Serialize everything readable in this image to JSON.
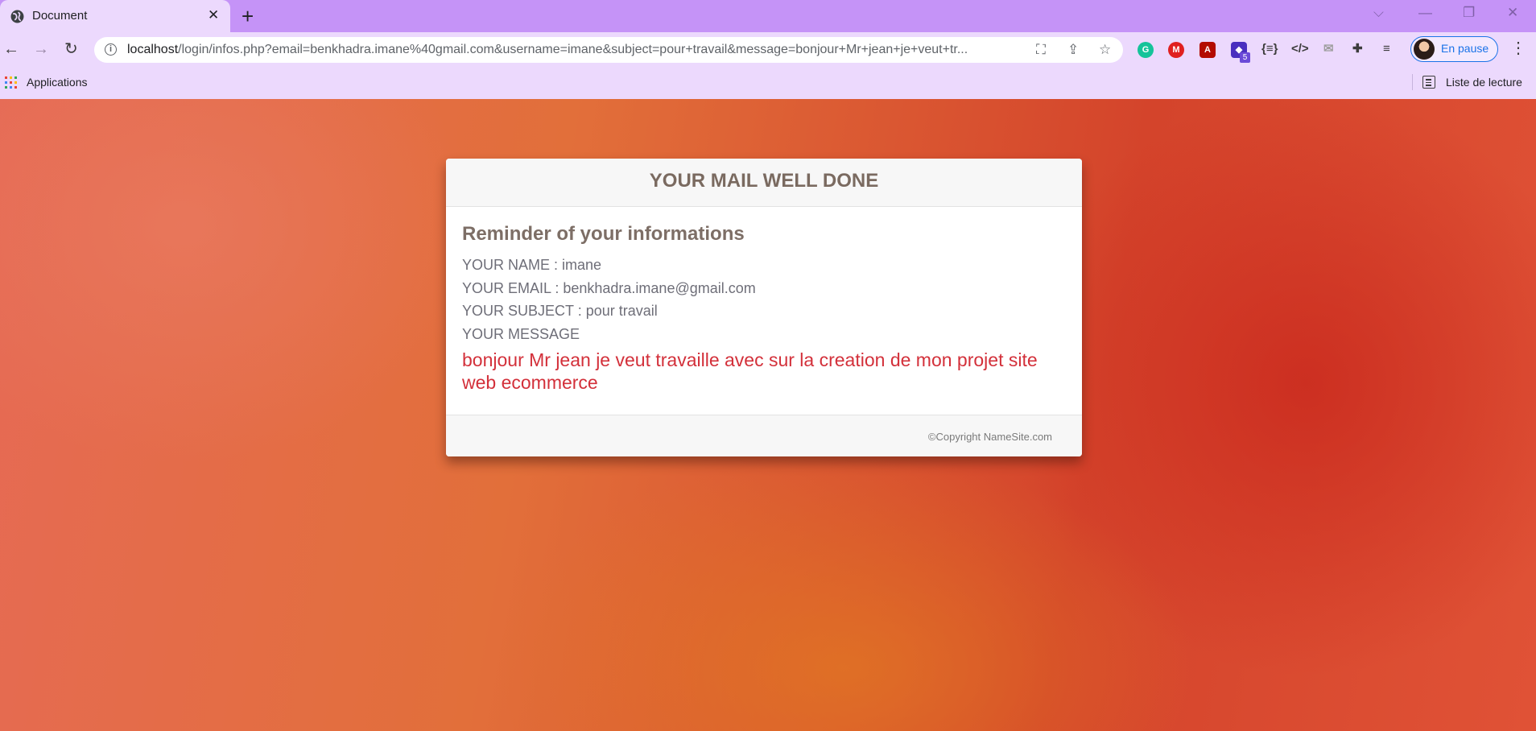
{
  "browser": {
    "tab": {
      "title": "Document",
      "close_icon": "close-icon"
    },
    "new_tab_icon": "plus-icon",
    "window_controls": [
      "chevron-down-icon",
      "minimize-icon",
      "restore-icon",
      "close-icon"
    ],
    "address": {
      "host": "localhost",
      "path": "/login/infos.php?email=benkhadra.imane%40gmail.com&username=imane&subject=pour+travail&message=bonjour+Mr+jean+je+veut+tr..."
    },
    "profile": {
      "label": "En pause"
    },
    "extension_badge": "5",
    "bookmarks": {
      "apps_label": "Applications",
      "reading_list_label": "Liste de lecture"
    },
    "colors": {
      "tabbar": "#c593f7",
      "toolbar": "#ecd9fd",
      "profile_accent": "#1a73e8"
    }
  },
  "card": {
    "header_title": "YOUR MAIL WELL DONE",
    "heading": "Reminder of your informations",
    "name_line": "YOUR NAME : imane",
    "email_line": "YOUR EMAIL : benkhadra.imane@gmail.com",
    "subject_line": "YOUR SUBJECT : pour travail",
    "message_label": "YOUR MESSAGE",
    "message_text": "bonjour Mr jean je veut travaille avec sur la creation de mon projet site web ecommerce",
    "footer": "©Copyright NameSite.com",
    "colors": {
      "message": "#d3303a",
      "heading": "#7d6e66"
    }
  }
}
